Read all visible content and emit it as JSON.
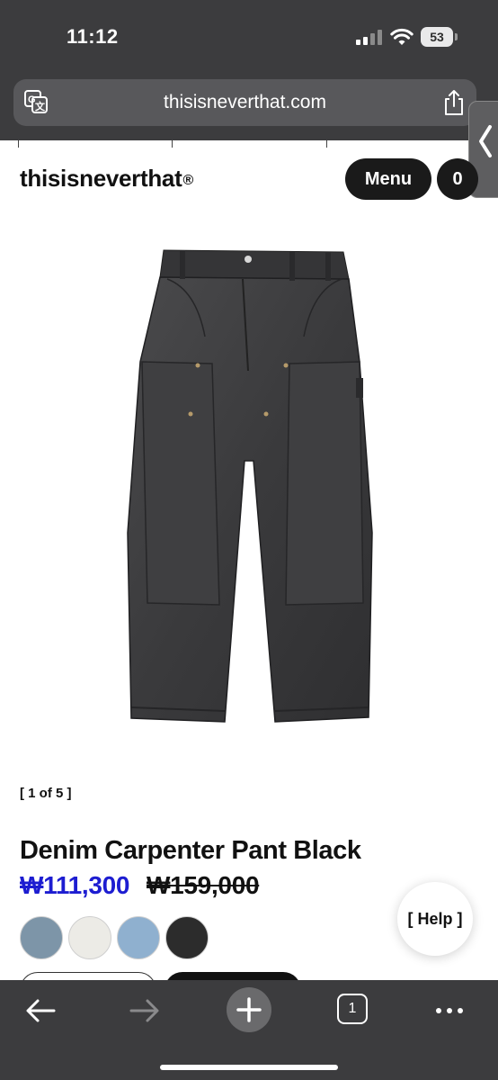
{
  "status_bar": {
    "time": "11:12",
    "battery": "53"
  },
  "browser": {
    "url": "thisisneverthat.com"
  },
  "header": {
    "brand": "thisisneverthat",
    "brand_mark": "®",
    "menu_label": "Menu",
    "cart_count": "0"
  },
  "product": {
    "counter": "[ 1 of 5 ]",
    "title": "Denim Carpenter Pant Black",
    "sale_price": "₩111,300",
    "original_price": "₩159,000",
    "swatches": [
      {
        "color": "#7d95a8"
      },
      {
        "color": "#ecebe6"
      },
      {
        "color": "#8fb0cf"
      },
      {
        "color": "#2c2c2c"
      }
    ]
  },
  "help": {
    "label": "[ Help ]"
  },
  "toolbar": {
    "tab_count": "1"
  },
  "colors": {
    "sale": "#1d1dd1",
    "chrome": "#3c3c3e",
    "button": "#1a1a1a"
  }
}
